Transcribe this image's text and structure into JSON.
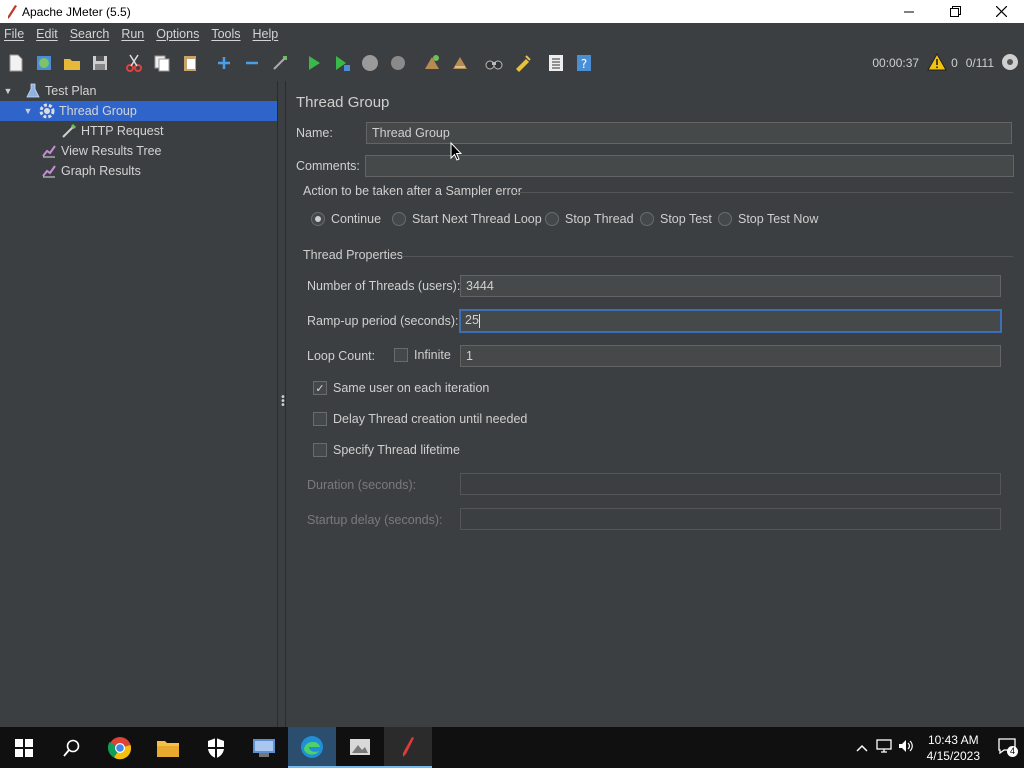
{
  "window": {
    "title": "Apache JMeter (5.5)"
  },
  "menu": [
    "File",
    "Edit",
    "Search",
    "Run",
    "Options",
    "Tools",
    "Help"
  ],
  "toolbar": {
    "timer": "00:00:37",
    "warnings": "0",
    "threads": "0/111",
    "icons": [
      "new-icon",
      "templates-icon",
      "open-icon",
      "save-icon",
      "cut-icon",
      "copy-icon",
      "paste-icon",
      "expand-icon",
      "collapse-icon",
      "toggle-icon",
      "start-icon",
      "start-no-pause-icon",
      "stop-icon",
      "shutdown-icon",
      "clear-icon",
      "clear-all-icon",
      "search-icon",
      "reset-search-icon",
      "function-helper-icon",
      "help-icon"
    ]
  },
  "tree": {
    "items": [
      {
        "label": "Test Plan",
        "icon": "test-plan-icon"
      },
      {
        "label": "Thread Group",
        "icon": "gear-icon"
      },
      {
        "label": "HTTP Request",
        "icon": "pipette-icon"
      },
      {
        "label": "View Results Tree",
        "icon": "chart-icon"
      },
      {
        "label": "Graph Results",
        "icon": "chart-icon"
      }
    ]
  },
  "panel": {
    "title": "Thread Group",
    "name_label": "Name:",
    "name_value": "Thread Group",
    "comments_label": "Comments:",
    "comments_value": "",
    "sampler_error_title": "Action to be taken after a Sampler error",
    "sampler_error_options": [
      "Continue",
      "Start Next Thread Loop",
      "Stop Thread",
      "Stop Test",
      "Stop Test Now"
    ],
    "sampler_error_selected": "Continue",
    "thread_props_title": "Thread Properties",
    "threads_label": "Number of Threads (users):",
    "threads_value": "3444",
    "rampup_label": "Ramp-up period (seconds):",
    "rampup_value": "25",
    "loop_label": "Loop Count:",
    "infinite_label": "Infinite",
    "infinite_checked": false,
    "loop_value": "1",
    "same_user_label": "Same user on each iteration",
    "same_user_checked": true,
    "delay_label": "Delay Thread creation until needed",
    "delay_checked": false,
    "lifetime_label": "Specify Thread lifetime",
    "lifetime_checked": false,
    "duration_label": "Duration (seconds):",
    "duration_value": "",
    "startup_label": "Startup delay (seconds):",
    "startup_value": ""
  },
  "taskbar": {
    "apps": [
      "start-icon",
      "search-icon",
      "chrome-icon",
      "file-explorer-icon",
      "security-icon",
      "network-app-icon",
      "edge-icon",
      "photos-icon",
      "jmeter-icon"
    ],
    "time": "10:43 AM",
    "date": "4/15/2023",
    "notifications": "4"
  }
}
